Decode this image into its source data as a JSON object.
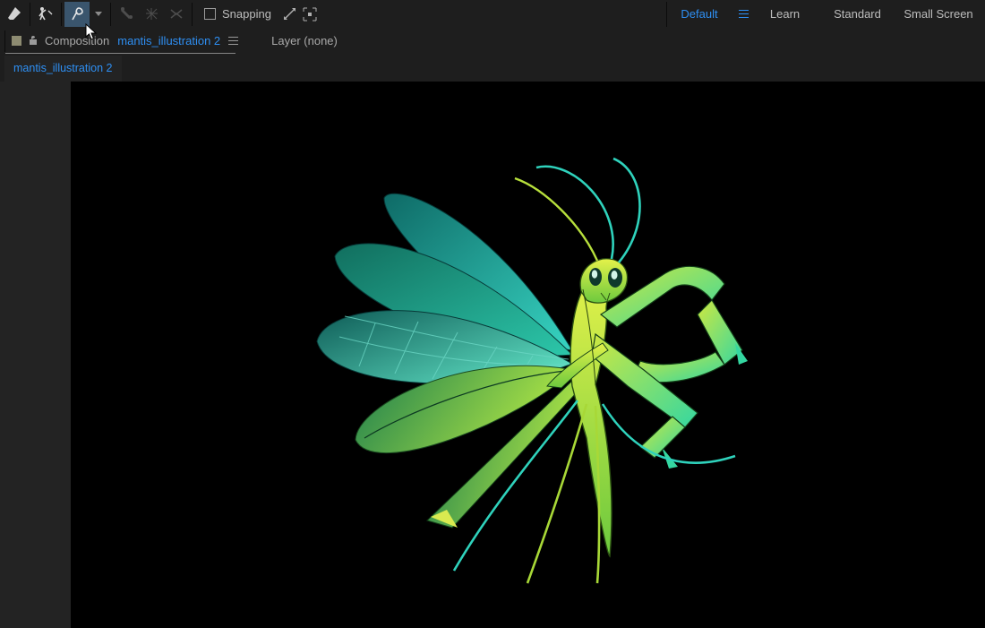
{
  "toolbar": {
    "snapping_label": "Snapping"
  },
  "workspace": {
    "default": "Default",
    "learn": "Learn",
    "standard": "Standard",
    "small_screen": "Small Screen"
  },
  "breadcrumb": {
    "lock_glyph": "🔓",
    "composition_label": "Composition",
    "composition_name": "mantis_illustration 2",
    "layer_label": "Layer (none)"
  },
  "tabs": {
    "active": "mantis_illustration 2"
  }
}
